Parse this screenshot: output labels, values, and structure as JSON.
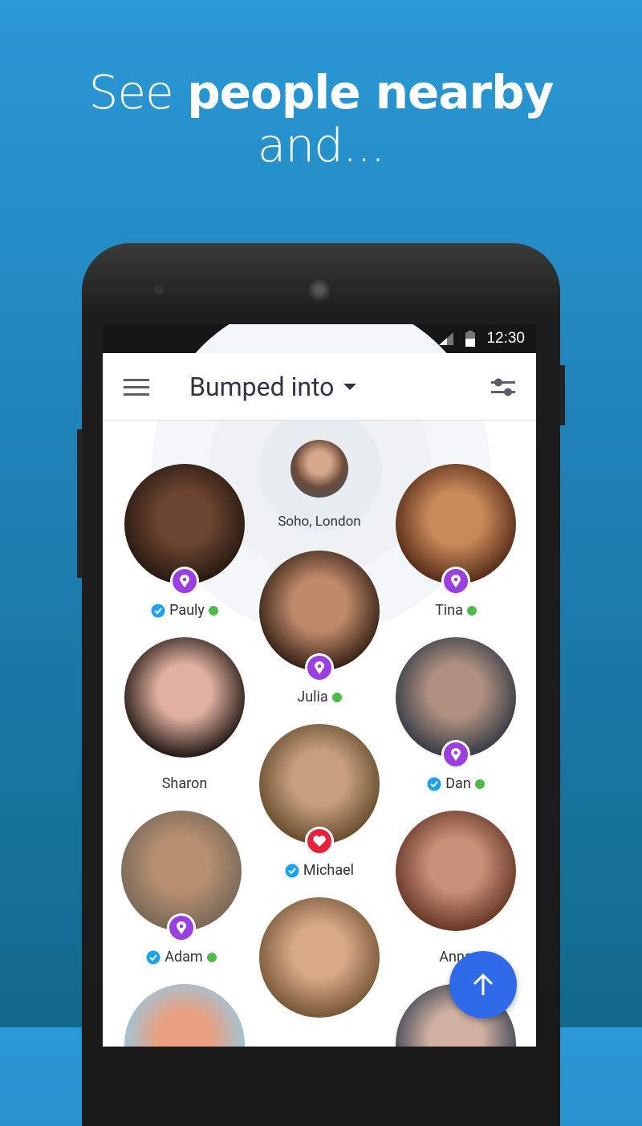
{
  "headline": {
    "regular": "See ",
    "bold": "people nearby",
    "line2": "and..."
  },
  "status": {
    "time": "12:30"
  },
  "appbar": {
    "title": "Bumped into",
    "menu_icon": "hamburger-icon",
    "filter_icon": "sliders-icon"
  },
  "location": {
    "label": "Soho, London"
  },
  "colors": {
    "location_badge": "#9b3fe0",
    "like_badge": "#e8213a",
    "verified": "#1da1f2",
    "online": "#4cbb4a",
    "fab": "#2f6be8"
  },
  "people": [
    {
      "name": "Pauly",
      "verified": true,
      "online": true,
      "badge": "location"
    },
    {
      "name": "Tina",
      "verified": false,
      "online": true,
      "badge": "location"
    },
    {
      "name": "Julia",
      "verified": false,
      "online": true,
      "badge": "location"
    },
    {
      "name": "Sharon",
      "verified": false,
      "online": false,
      "badge": ""
    },
    {
      "name": "Dan",
      "verified": true,
      "online": true,
      "badge": "location"
    },
    {
      "name": "Michael",
      "verified": true,
      "online": false,
      "badge": "heart"
    },
    {
      "name": "Adam",
      "verified": true,
      "online": true,
      "badge": "location"
    },
    {
      "name": "Anna",
      "verified": false,
      "online": false,
      "badge": ""
    },
    {
      "name": "",
      "verified": false,
      "online": false,
      "badge": ""
    },
    {
      "name": "",
      "verified": false,
      "online": false,
      "badge": ""
    },
    {
      "name": "",
      "verified": false,
      "online": false,
      "badge": ""
    }
  ],
  "fab": {
    "icon": "arrow-up-icon"
  }
}
